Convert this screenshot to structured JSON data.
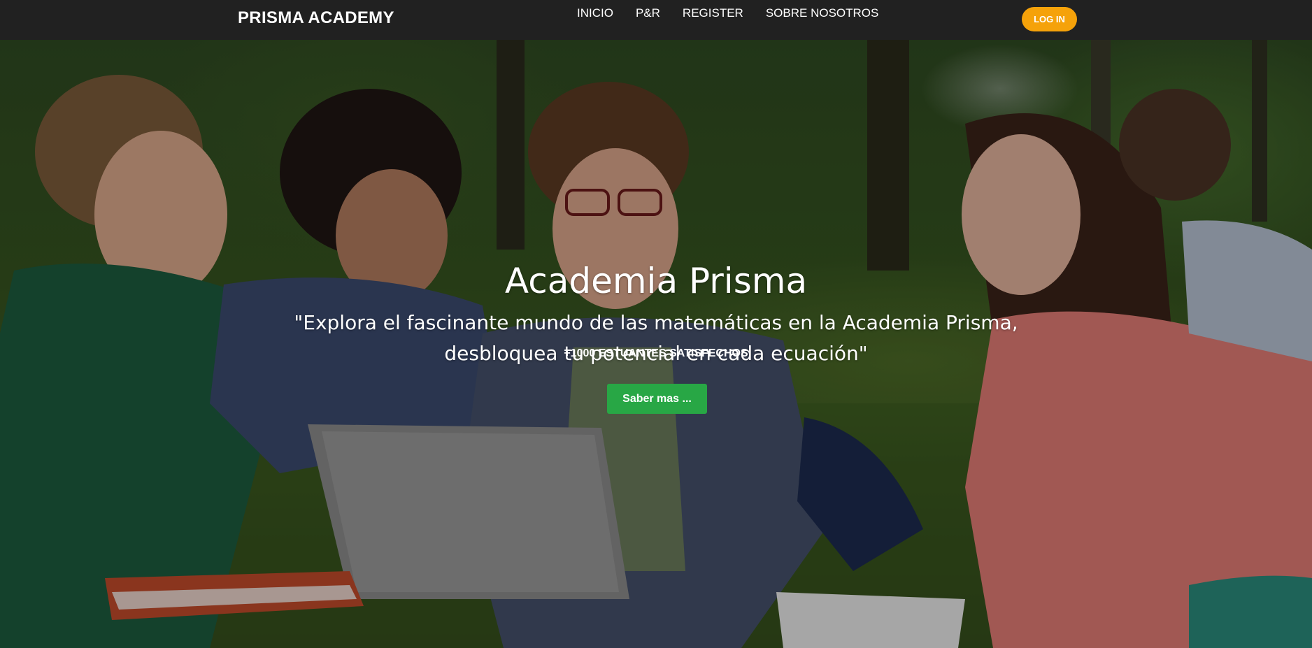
{
  "navbar": {
    "brand": "PRISMA ACADEMY",
    "links": [
      {
        "label": "INICIO"
      },
      {
        "label": "P&R"
      },
      {
        "label": "REGISTER"
      },
      {
        "label": "SOBRE NOSOTROS"
      }
    ],
    "login_label": "LOG IN",
    "login_color": "#f5a20a",
    "background_color": "#212121"
  },
  "hero": {
    "title": "Academia Prisma",
    "quote_line1": "\"Explora el fascinante mundo de las matemáticas en la Academia Prisma,",
    "quote_line2": "desbloquea tu potencial en cada ecuación\"",
    "stat": "+1000 ESTUANTES SATISFECHOS",
    "cta_label": "Saber mas ...",
    "cta_color": "#28a745",
    "background_image": "photo-of-students-with-laptop-in-park"
  }
}
